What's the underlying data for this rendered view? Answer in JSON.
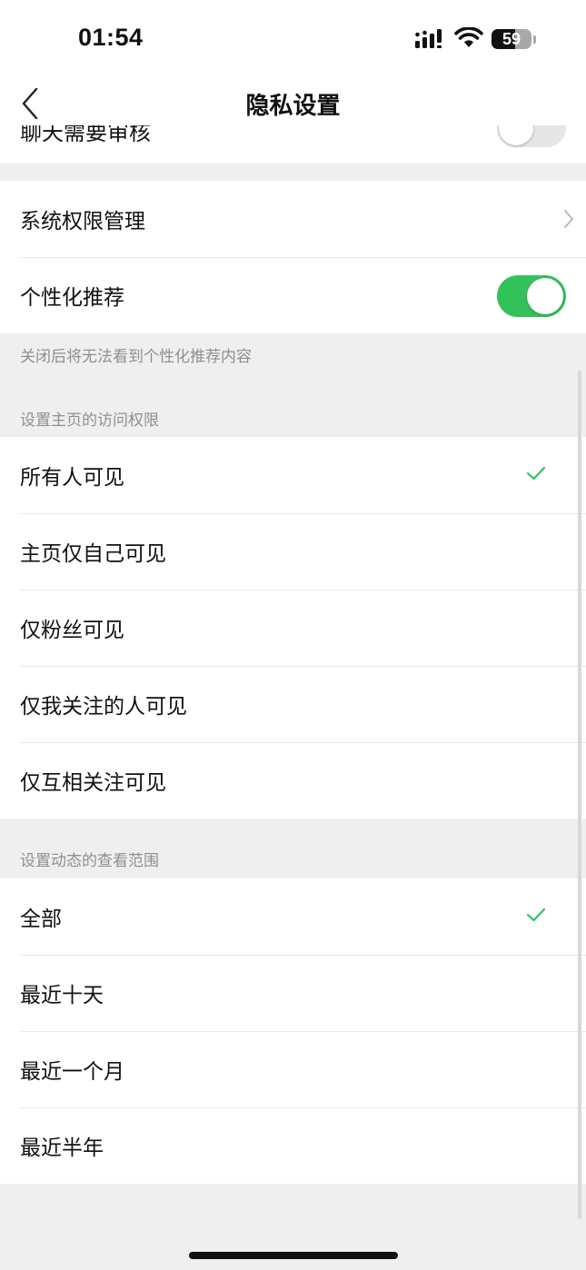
{
  "status_bar": {
    "time": "01:54",
    "battery": "59",
    "battery_level": 0.59
  },
  "nav": {
    "title": "隐私设置",
    "partial_row_label": "聊天需要审核"
  },
  "system": {
    "permissions_label": "系统权限管理",
    "personalized_label": "个性化推荐",
    "personalized_enabled": true,
    "personalized_note": "关闭后将无法看到个性化推荐内容"
  },
  "homepage_access": {
    "header": "设置主页的访问权限",
    "options": [
      "所有人可见",
      "主页仅自己可见",
      "仅粉丝可见",
      "仅我关注的人可见",
      "仅互相关注可见"
    ],
    "selected": "所有人可见"
  },
  "feed_scope": {
    "header": "设置动态的查看范围",
    "options": [
      "全部",
      "最近十天",
      "最近一个月",
      "最近半年"
    ],
    "selected": "全部"
  },
  "colors": {
    "accent": "#33c25a",
    "background": "#efefef"
  }
}
